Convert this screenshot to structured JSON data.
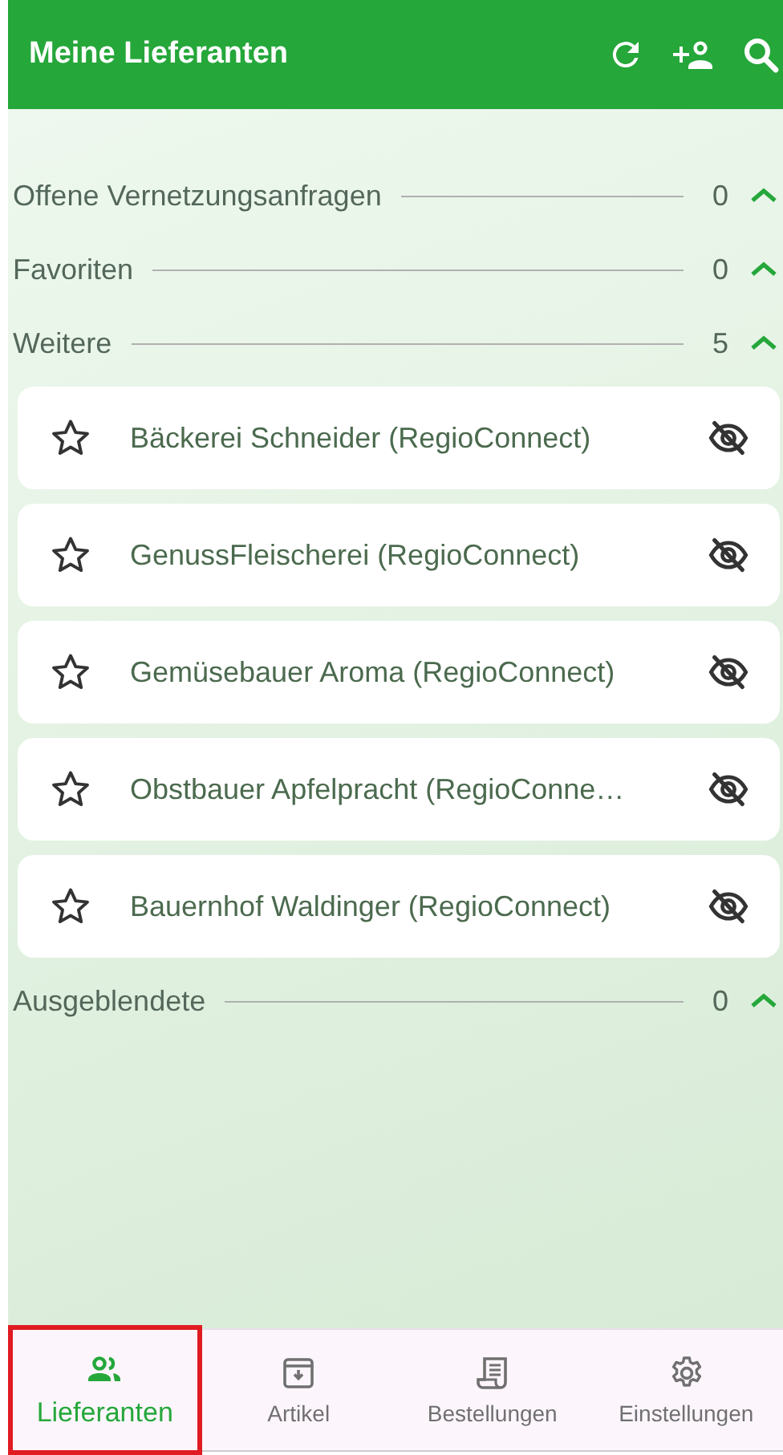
{
  "header": {
    "title": "Meine Lieferanten"
  },
  "sections": [
    {
      "title": "Offene Vernetzungsanfragen",
      "count": "0",
      "expanded": true
    },
    {
      "title": "Favoriten",
      "count": "0",
      "expanded": true
    },
    {
      "title": "Weitere",
      "count": "5",
      "expanded": true,
      "items": [
        {
          "name": "Bäckerei Schneider (RegioConnect)",
          "favorite": false
        },
        {
          "name": "GenussFleischerei (RegioConnect)",
          "favorite": false
        },
        {
          "name": "Gemüsebauer Aroma (RegioConnect)",
          "favorite": false
        },
        {
          "name": "Obstbauer Apfelpracht (RegioConne…",
          "favorite": false
        },
        {
          "name": "Bauernhof Waldinger (RegioConnect)",
          "favorite": false
        }
      ]
    },
    {
      "title": "Ausgeblendete",
      "count": "0",
      "expanded": true
    }
  ],
  "bottom_nav": [
    {
      "kind": "suppliers",
      "label": "Lieferanten",
      "selected": true,
      "highlighted": true
    },
    {
      "kind": "articles",
      "label": "Artikel",
      "selected": false,
      "highlighted": false
    },
    {
      "kind": "orders",
      "label": "Bestellungen",
      "selected": false,
      "highlighted": false
    },
    {
      "kind": "settings",
      "label": "Einstellungen",
      "selected": false,
      "highlighted": false
    }
  ]
}
